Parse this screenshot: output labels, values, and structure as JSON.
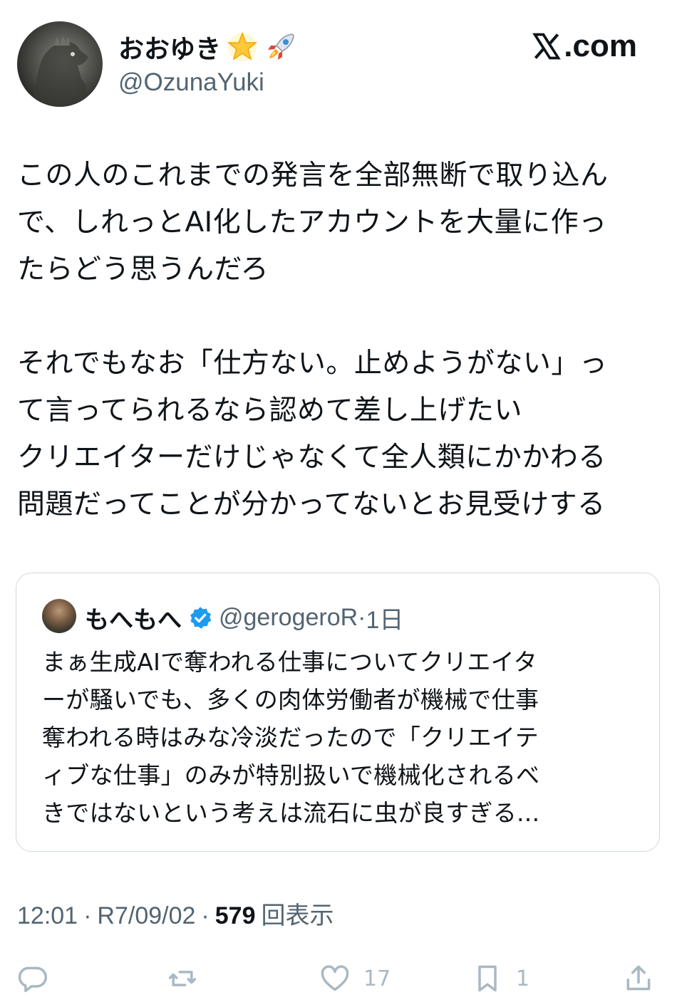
{
  "author": {
    "display_name": "おおゆき",
    "handle": "@OzunaYuki",
    "name_emojis": [
      "star-icon",
      "rocket-icon"
    ]
  },
  "brand": {
    "label": ".com"
  },
  "tweet": {
    "lines": [
      "この人のこれまでの発言を全部無断で取り込ん",
      "で、しれっとAI化したアカウントを大量に作っ",
      "たらどう思うんだろ",
      "",
      "それでもなお「仕方ない。止めようがない」っ",
      "て言ってられるなら認めて差し上げたい",
      "クリエイターだけじゃなくて全人類にかかわる",
      "問題だってことが分かってないとお見受けする"
    ]
  },
  "quote": {
    "display_name": "もへもへ",
    "verified": true,
    "handle": "@gerogeroR",
    "separator": "·",
    "time": "1日",
    "lines": [
      "まぁ生成AIで奪われる仕事についてクリエイタ",
      "ーが騒いでも、多くの肉体労働者が機械で仕事",
      "奪われる時はみな冷淡だったので「クリエイテ",
      "ィブな仕事」のみが特別扱いで機械化されるべ",
      "きではないという考えは流石に虫が良すぎる..."
    ]
  },
  "meta": {
    "time": "12:01",
    "sep1": "·",
    "date": "R7/09/02",
    "sep2": "·",
    "views": "579",
    "views_label": "回表示"
  },
  "actions": {
    "reply_count": "",
    "retweet_count": "",
    "like_count": "17",
    "bookmark_count": "1"
  },
  "colors": {
    "text": "#0f1419",
    "secondary": "#536471",
    "verified": "#1d9bf0",
    "border": "#cfd9de",
    "action_icons": "#aab8c2"
  }
}
